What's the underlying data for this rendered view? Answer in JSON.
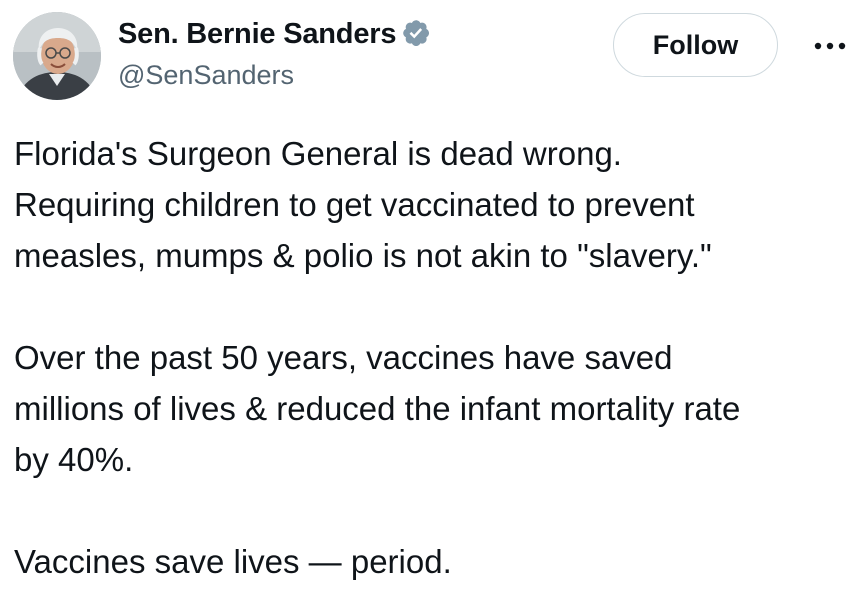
{
  "author": {
    "display_name": "Sen. Bernie Sanders",
    "handle": "@SenSanders",
    "verified_icon": "verified-badge-icon",
    "verified_color": "#829aab"
  },
  "actions": {
    "follow_label": "Follow",
    "more_icon": "more-options-icon"
  },
  "tweet": {
    "paragraphs": [
      {
        "lines": [
          "Florida's Surgeon General is dead wrong.",
          "Requiring children to get vaccinated to prevent",
          "measles, mumps & polio is not akin to \"slavery.\""
        ]
      },
      {
        "lines": [
          "Over the past 50 years, vaccines have saved",
          "millions of lives & reduced the infant mortality rate",
          "by 40%."
        ]
      },
      {
        "lines": [
          "Vaccines save lives — period."
        ]
      }
    ]
  },
  "colors": {
    "text_primary": "#0f1419",
    "text_secondary": "#536471",
    "button_border": "#cfd9de"
  }
}
